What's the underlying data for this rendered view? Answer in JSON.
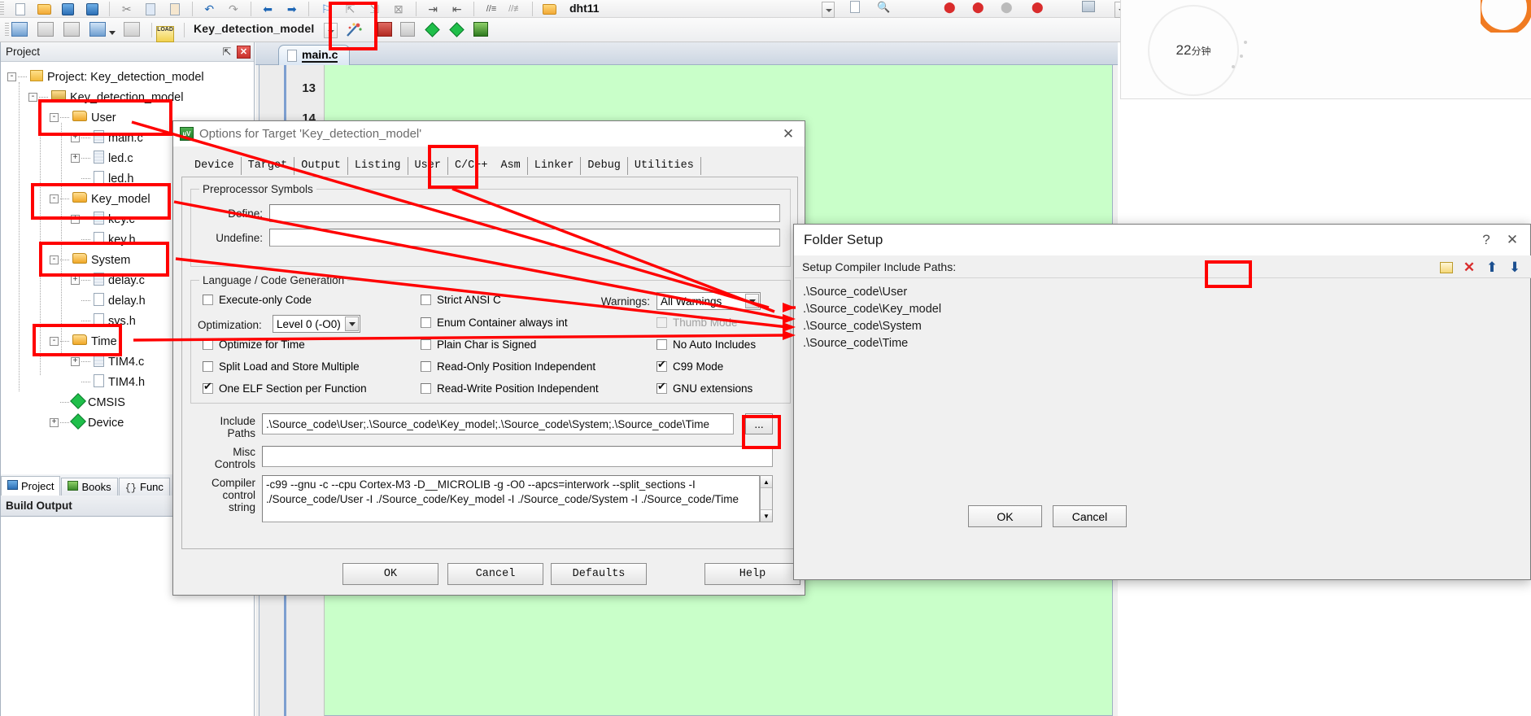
{
  "toolbar": {
    "target_name": "Key_detection_model",
    "row1_icons": [
      "new-file-icon",
      "open-folder-icon",
      "save-icon",
      "save-all-icon",
      "cut-icon",
      "copy-icon",
      "paste-icon",
      "undo-icon",
      "redo-icon",
      "nav-back-icon",
      "nav-forward-icon",
      "insert-bookmark-icon",
      "prev-bookmark-icon",
      "next-bookmark-icon",
      "clear-bookmarks-icon",
      "indent-icon",
      "outdent-icon",
      "comment-icon",
      "uncomment-icon",
      "open-folder2-icon"
    ],
    "row2_icons": [
      "translate-icon",
      "build-icon",
      "rebuild-icon",
      "batch-build-icon",
      "stop-build-icon",
      "download-icon",
      "checkbox-icon",
      "target-options-icon",
      "manage-project-icon",
      "multi-project-icon",
      "cmsis-pack-icon",
      "pack-installer-icon",
      "env-icon"
    ],
    "filename_field": "dht11"
  },
  "project_panel": {
    "title": "Project",
    "pin_icon": "pin-icon",
    "close_icon": "close-icon",
    "tree": [
      {
        "label": "Project: Key_detection_model",
        "indent": 0,
        "expander": "-",
        "icon": "project-icon"
      },
      {
        "label": "Key_detection_model",
        "indent": 1,
        "expander": "-",
        "icon": "target-icon"
      },
      {
        "label": "User",
        "indent": 2,
        "expander": "-",
        "icon": "folder-icon"
      },
      {
        "label": "main.c",
        "indent": 3,
        "expander": "+",
        "icon": "c-file-icon"
      },
      {
        "label": "led.c",
        "indent": 3,
        "expander": "+",
        "icon": "c-file-icon"
      },
      {
        "label": "led.h",
        "indent": 3,
        "expander": "",
        "icon": "h-file-icon"
      },
      {
        "label": "Key_model",
        "indent": 2,
        "expander": "-",
        "icon": "folder-icon"
      },
      {
        "label": "key.c",
        "indent": 3,
        "expander": "+",
        "icon": "c-file-icon"
      },
      {
        "label": "key.h",
        "indent": 3,
        "expander": "",
        "icon": "h-file-icon"
      },
      {
        "label": "System",
        "indent": 2,
        "expander": "-",
        "icon": "folder-icon"
      },
      {
        "label": "delay.c",
        "indent": 3,
        "expander": "+",
        "icon": "c-file-icon"
      },
      {
        "label": "delay.h",
        "indent": 3,
        "expander": "",
        "icon": "h-file-icon"
      },
      {
        "label": "sys.h",
        "indent": 3,
        "expander": "",
        "icon": "h-file-icon"
      },
      {
        "label": "Time",
        "indent": 2,
        "expander": "-",
        "icon": "folder-icon"
      },
      {
        "label": "TIM4.c",
        "indent": 3,
        "expander": "+",
        "icon": "c-file-icon"
      },
      {
        "label": "TIM4.h",
        "indent": 3,
        "expander": "",
        "icon": "h-file-icon"
      },
      {
        "label": "CMSIS",
        "indent": 2,
        "expander": "",
        "icon": "cmsis-icon"
      },
      {
        "label": "Device",
        "indent": 2,
        "expander": "+",
        "icon": "cmsis-icon"
      }
    ],
    "bottom_tabs": [
      {
        "label": "Project",
        "icon": "project-tab-icon",
        "active": true
      },
      {
        "label": "Books",
        "icon": "books-tab-icon",
        "active": false
      },
      {
        "label": "Func",
        "icon": "functions-tab-icon",
        "active": false
      }
    ],
    "build_output_label": "Build Output"
  },
  "editor": {
    "tab_label": "main.c",
    "tab_icon": "source-file-icon",
    "line_numbers": [
      "13",
      "14"
    ]
  },
  "options_dialog": {
    "title": "Options for Target 'Key_detection_model'",
    "icon": "keil-uvision-icon",
    "close_icon": "close-icon",
    "tabs": [
      {
        "label": "Device",
        "active": false
      },
      {
        "label": "Target",
        "active": false
      },
      {
        "label": "Output",
        "active": false
      },
      {
        "label": "Listing",
        "active": false
      },
      {
        "label": "User",
        "active": false
      },
      {
        "label": "C/C++",
        "active": true
      },
      {
        "label": "Asm",
        "active": false
      },
      {
        "label": "Linker",
        "active": false
      },
      {
        "label": "Debug",
        "active": false
      },
      {
        "label": "Utilities",
        "active": false
      }
    ],
    "preprocessor": {
      "group_title": "Preprocessor Symbols",
      "define_label": "Define:",
      "define_value": "",
      "undefine_label": "Undefine:",
      "undefine_value": ""
    },
    "language": {
      "group_title": "Language / Code Generation",
      "checkboxes_col1": [
        {
          "label": "Execute-only Code",
          "checked": false,
          "disabled": false
        },
        {
          "label": "Optimize for Time",
          "checked": false,
          "disabled": false
        },
        {
          "label": "Split Load and Store Multiple",
          "checked": false,
          "disabled": false
        },
        {
          "label": "One ELF Section per Function",
          "checked": true,
          "disabled": false
        }
      ],
      "optimization_label": "Optimization:",
      "optimization_value": "Level 0 (-O0)",
      "checkboxes_col2": [
        {
          "label": "Strict ANSI C",
          "checked": false,
          "disabled": false
        },
        {
          "label": "Enum Container always int",
          "checked": false,
          "disabled": false
        },
        {
          "label": "Plain Char is Signed",
          "checked": false,
          "disabled": false
        },
        {
          "label": "Read-Only Position Independent",
          "checked": false,
          "disabled": false
        },
        {
          "label": "Read-Write Position Independent",
          "checked": false,
          "disabled": false
        }
      ],
      "warnings_label": "Warnings:",
      "warnings_value": "All Warnings",
      "checkboxes_col3": [
        {
          "label": "Thumb Mode",
          "checked": false,
          "disabled": true
        },
        {
          "label": "No Auto Includes",
          "checked": false,
          "disabled": false
        },
        {
          "label": "C99 Mode",
          "checked": true,
          "disabled": false
        },
        {
          "label": "GNU extensions",
          "checked": true,
          "disabled": false
        }
      ]
    },
    "include_paths_label": "Include\nPaths",
    "include_paths_value": ".\\Source_code\\User;.\\Source_code\\Key_model;.\\Source_code\\System;.\\Source_code\\Time",
    "include_browse_label": "...",
    "misc_controls_label": "Misc\nControls",
    "misc_controls_value": "",
    "compiler_label": "Compiler\ncontrol\nstring",
    "compiler_value": "-c99 --gnu -c --cpu Cortex-M3 -D__MICROLIB -g -O0 --apcs=interwork --split_sections -I ./Source_code/User -I ./Source_code/Key_model -I ./Source_code/System -I ./Source_code/Time",
    "buttons": [
      {
        "label": "OK"
      },
      {
        "label": "Cancel"
      },
      {
        "label": "Defaults"
      },
      {
        "label": "Help"
      }
    ]
  },
  "folder_setup": {
    "title": "Folder Setup",
    "help_icon": "question-mark-icon",
    "close_icon": "close-icon",
    "header_label": "Setup Compiler Include Paths:",
    "toolbar_icons": [
      "new-path-icon",
      "delete-path-icon",
      "move-up-icon",
      "move-down-icon"
    ],
    "paths": [
      ".\\Source_code\\User",
      ".\\Source_code\\Key_model",
      ".\\Source_code\\System",
      ".\\Source_code\\Time"
    ],
    "ok_label": "OK",
    "cancel_label": "Cancel"
  },
  "timer_widget": {
    "value": "22",
    "unit": "分钟"
  },
  "annotations": {
    "highlight_color": "#ff0000",
    "boxes": [
      "target-options-toolbar-button",
      "tree-node-user",
      "tree-node-key-model",
      "tree-node-system",
      "tree-node-time",
      "cpp-tab",
      "include-paths-browse-button",
      "folder-setup-new-path-button"
    ],
    "arrow_count": 6
  }
}
